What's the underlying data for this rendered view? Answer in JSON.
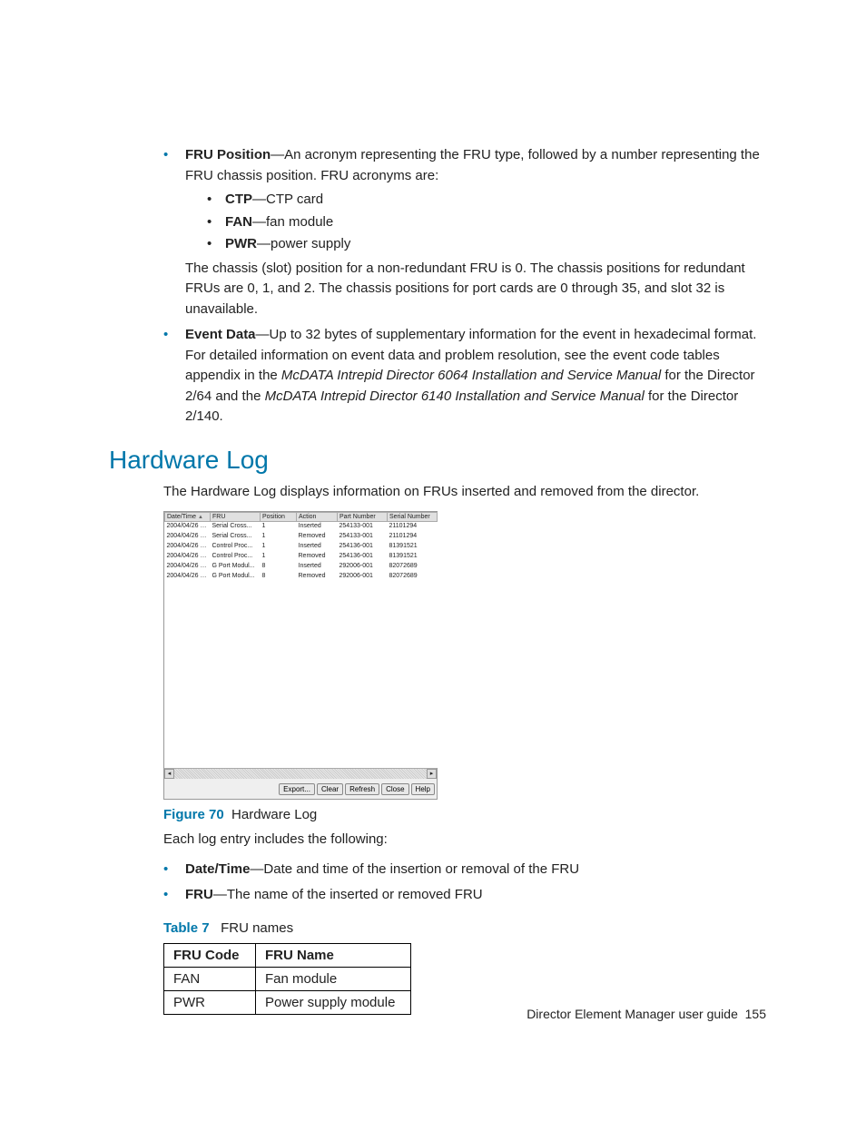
{
  "bullets": {
    "fru_position_label": "FRU Position",
    "fru_position_text": "—An acronym representing the FRU type, followed by a number representing the FRU chassis position. FRU acronyms are:",
    "sub": {
      "ctp_label": "CTP",
      "ctp_text": "—CTP card",
      "fan_label": "FAN",
      "fan_text": "—fan module",
      "pwr_label": "PWR",
      "pwr_text": "—power supply"
    },
    "fru_position_post": "The chassis (slot) position for a non-redundant FRU is 0. The chassis positions for redundant FRUs are 0, 1, and 2. The chassis positions for port cards are 0 through 35, and slot 32 is unavailable.",
    "event_data_label": "Event Data",
    "event_data_pre": "—Up to 32 bytes of supplementary information for the event in hexadecimal format. For detailed information on event data and problem resolution, see the event code tables appendix in the ",
    "event_data_manual1": "McDATA Intrepid Director 6064 Installation and Service Manual",
    "event_data_mid": " for the Director 2/64 and the ",
    "event_data_manual2": "McDATA Intrepid Director 6140 Installation and Service Manual",
    "event_data_post": " for the Director 2/140."
  },
  "section_heading": "Hardware Log",
  "section_intro": "The Hardware Log displays information on FRUs inserted and removed from the director.",
  "hwlog": {
    "headers": {
      "dt": "Date/Time",
      "fru": "FRU",
      "pos": "Position",
      "action": "Action",
      "pn": "Part Number",
      "sn": "Serial Number"
    },
    "rows": [
      {
        "dt": "2004/04/26 1...",
        "fru": "Serial Cross...",
        "pos": "1",
        "action": "Inserted",
        "pn": "254133-001",
        "sn": "21101294"
      },
      {
        "dt": "2004/04/26 1...",
        "fru": "Serial Cross...",
        "pos": "1",
        "action": "Removed",
        "pn": "254133-001",
        "sn": "21101294"
      },
      {
        "dt": "2004/04/26 1...",
        "fru": "Control Proc...",
        "pos": "1",
        "action": "Inserted",
        "pn": "254136-001",
        "sn": "81391521"
      },
      {
        "dt": "2004/04/26 1...",
        "fru": "Control Proc...",
        "pos": "1",
        "action": "Removed",
        "pn": "254136-001",
        "sn": "81391521"
      },
      {
        "dt": "2004/04/26 1...",
        "fru": "G Port Modul...",
        "pos": "8",
        "action": "Inserted",
        "pn": "292006-001",
        "sn": "82072689"
      },
      {
        "dt": "2004/04/26 1...",
        "fru": "G Port Modul...",
        "pos": "8",
        "action": "Removed",
        "pn": "292006-001",
        "sn": "82072689"
      }
    ],
    "buttons": {
      "export": "Export...",
      "clear": "Clear",
      "refresh": "Refresh",
      "close": "Close",
      "help": "Help"
    }
  },
  "figure": {
    "label": "Figure 70",
    "text": "Hardware Log"
  },
  "post_figure": "Each log entry includes the following:",
  "entry_bullets": {
    "dt_label": "Date/Time",
    "dt_text": "—Date and time of the insertion or removal of the FRU",
    "fru_label": "FRU",
    "fru_text": "—The name of the inserted or removed FRU"
  },
  "table_caption": {
    "label": "Table 7",
    "text": "FRU names"
  },
  "fru_table": {
    "head": {
      "code": "FRU Code",
      "name": "FRU Name"
    },
    "rows": [
      {
        "code": "FAN",
        "name": "Fan module"
      },
      {
        "code": "PWR",
        "name": "Power supply module"
      }
    ]
  },
  "footer": {
    "title": "Director Element Manager user guide",
    "page": "155"
  }
}
